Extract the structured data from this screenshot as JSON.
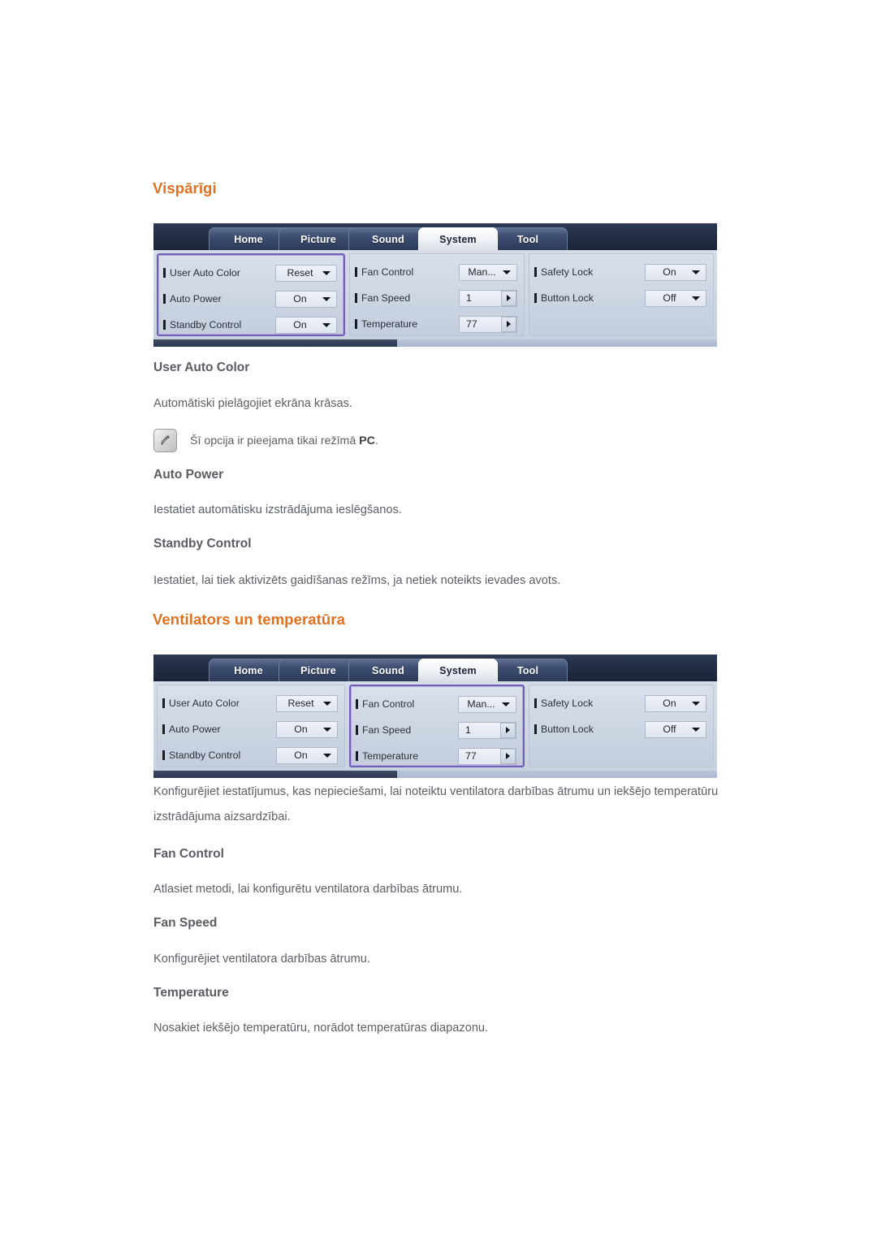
{
  "page": {
    "sections": [
      {
        "heading": "Vispārīgi",
        "osd": {
          "selected_column": 0,
          "tabs": [
            {
              "label": "Home",
              "active": false
            },
            {
              "label": "Picture",
              "active": false
            },
            {
              "label": "Sound",
              "active": false
            },
            {
              "label": "System",
              "active": true
            },
            {
              "label": "Tool",
              "active": false
            }
          ],
          "columns": [
            {
              "rows": [
                {
                  "label": "User Auto Color",
                  "value": "Reset",
                  "control": "dropdown"
                },
                {
                  "label": "Auto Power",
                  "value": "On",
                  "control": "dropdown"
                },
                {
                  "label": "Standby Control",
                  "value": "On",
                  "control": "dropdown"
                }
              ]
            },
            {
              "rows": [
                {
                  "label": "Fan Control",
                  "value": "Man...",
                  "control": "dropdown"
                },
                {
                  "label": "Fan Speed",
                  "value": "1",
                  "control": "spinner"
                },
                {
                  "label": "Temperature",
                  "value": "77",
                  "control": "spinner"
                }
              ]
            },
            {
              "rows": [
                {
                  "label": "Safety Lock",
                  "value": "On",
                  "control": "dropdown"
                },
                {
                  "label": "Button Lock",
                  "value": "Off",
                  "control": "dropdown"
                }
              ]
            }
          ]
        },
        "items": [
          {
            "title": "User Auto Color",
            "description": "Automātiski pielāgojiet ekrāna krāsas.",
            "note": {
              "icon": "note-pencil-icon",
              "text_before": "Šī opcija ir pieejama tikai režīmā ",
              "emphasis": "PC",
              "text_after": "."
            }
          },
          {
            "title": "Auto Power",
            "description": "Iestatiet automātisku izstrādājuma ieslēgšanos."
          },
          {
            "title": "Standby Control",
            "description": "Iestatiet, lai tiek aktivizēts gaidīšanas režīms, ja netiek noteikts ievades avots."
          }
        ]
      },
      {
        "heading": "Ventilators un temperatūra",
        "osd": {
          "selected_column": 1,
          "tabs": [
            {
              "label": "Home",
              "active": false
            },
            {
              "label": "Picture",
              "active": false
            },
            {
              "label": "Sound",
              "active": false
            },
            {
              "label": "System",
              "active": true
            },
            {
              "label": "Tool",
              "active": false
            }
          ],
          "columns": [
            {
              "rows": [
                {
                  "label": "User Auto Color",
                  "value": "Reset",
                  "control": "dropdown"
                },
                {
                  "label": "Auto Power",
                  "value": "On",
                  "control": "dropdown"
                },
                {
                  "label": "Standby Control",
                  "value": "On",
                  "control": "dropdown"
                }
              ]
            },
            {
              "rows": [
                {
                  "label": "Fan Control",
                  "value": "Man...",
                  "control": "dropdown"
                },
                {
                  "label": "Fan Speed",
                  "value": "1",
                  "control": "spinner"
                },
                {
                  "label": "Temperature",
                  "value": "77",
                  "control": "spinner"
                }
              ]
            },
            {
              "rows": [
                {
                  "label": "Safety Lock",
                  "value": "On",
                  "control": "dropdown"
                },
                {
                  "label": "Button Lock",
                  "value": "Off",
                  "control": "dropdown"
                }
              ]
            }
          ]
        },
        "intro": "Konfigurējiet iestatījumus, kas nepieciešami, lai noteiktu ventilatora darbības ātrumu un iekšējo temperatūru izstrādājuma aizsardzībai.",
        "items": [
          {
            "title": "Fan Control",
            "description": "Atlasiet metodi, lai konfigurētu ventilatora darbības ātrumu."
          },
          {
            "title": "Fan Speed",
            "description": "Konfigurējiet ventilatora darbības ātrumu."
          },
          {
            "title": "Temperature",
            "description": "Nosakiet iekšējo temperatūru, norādot temperatūras diapazonu."
          }
        ]
      }
    ]
  },
  "colors": {
    "heading_orange": "#e1701f",
    "body_gray": "#5a5f65",
    "selection_purple": "#6f5fb5",
    "osd_titlebar": "#232e46"
  }
}
